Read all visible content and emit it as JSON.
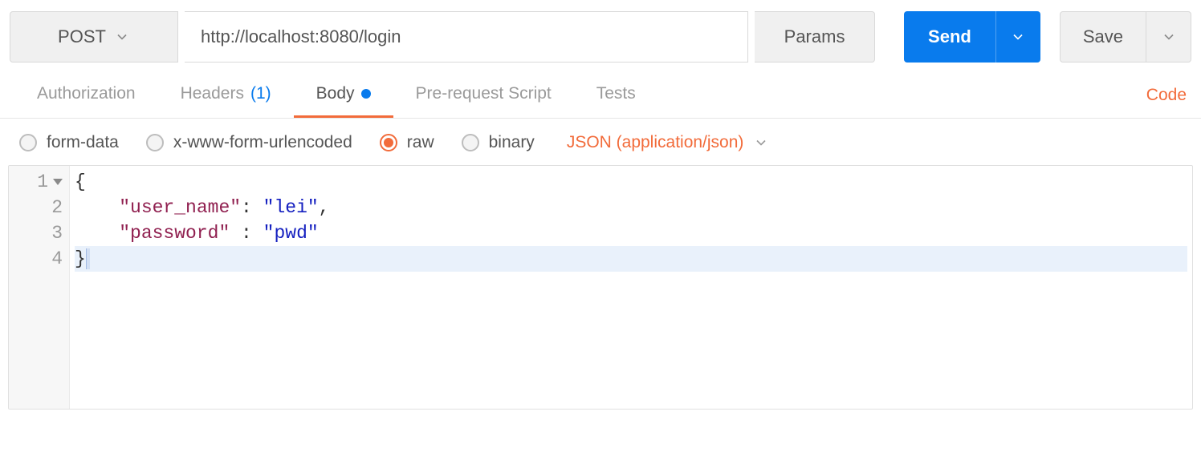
{
  "request": {
    "method": "POST",
    "url": "http://localhost:8080/login",
    "params_label": "Params",
    "send_label": "Send",
    "save_label": "Save"
  },
  "tabs": {
    "authorization": "Authorization",
    "headers_label": "Headers",
    "headers_count": "(1)",
    "body": "Body",
    "prerequest": "Pre-request Script",
    "tests": "Tests",
    "code_link": "Code"
  },
  "body_types": {
    "form_data": "form-data",
    "urlencoded": "x-www-form-urlencoded",
    "raw": "raw",
    "binary": "binary",
    "content_type": "JSON (application/json)"
  },
  "editor": {
    "line_numbers": [
      "1",
      "2",
      "3",
      "4"
    ],
    "lines": [
      {
        "type": "brace",
        "text": "{"
      },
      {
        "type": "kv",
        "indent": "    ",
        "key": "\"user_name\"",
        "sep": ": ",
        "val": "\"lei\"",
        "trail": ","
      },
      {
        "type": "kv",
        "indent": "    ",
        "key": "\"password\"",
        "sep": " : ",
        "val": "\"pwd\"",
        "trail": ""
      },
      {
        "type": "brace",
        "text": "}"
      }
    ],
    "highlighted_line": 4
  }
}
